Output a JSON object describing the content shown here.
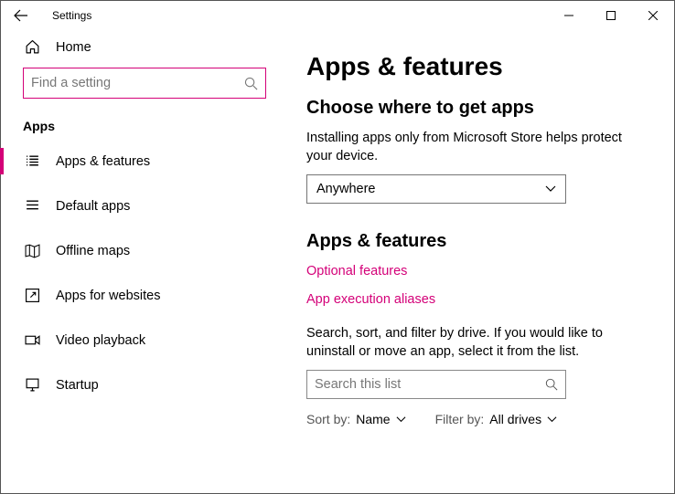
{
  "titlebar": {
    "title": "Settings"
  },
  "sidebar": {
    "home_label": "Home",
    "search_placeholder": "Find a setting",
    "section": "Apps",
    "items": [
      {
        "label": "Apps & features"
      },
      {
        "label": "Default apps"
      },
      {
        "label": "Offline maps"
      },
      {
        "label": "Apps for websites"
      },
      {
        "label": "Video playback"
      },
      {
        "label": "Startup"
      }
    ]
  },
  "main": {
    "page_title": "Apps & features",
    "choose_heading": "Choose where to get apps",
    "choose_description": "Installing apps only from Microsoft Store helps protect your device.",
    "source_dropdown": {
      "value": "Anywhere"
    },
    "apps_heading": "Apps & features",
    "links": {
      "optional": "Optional features",
      "aliases": "App execution aliases"
    },
    "filter_description": "Search, sort, and filter by drive. If you would like to uninstall or move an app, select it from the list.",
    "list_search_placeholder": "Search this list",
    "sort": {
      "label": "Sort by:",
      "value": "Name"
    },
    "filter": {
      "label": "Filter by:",
      "value": "All drives"
    }
  },
  "colors": {
    "accent": "#d40078"
  }
}
